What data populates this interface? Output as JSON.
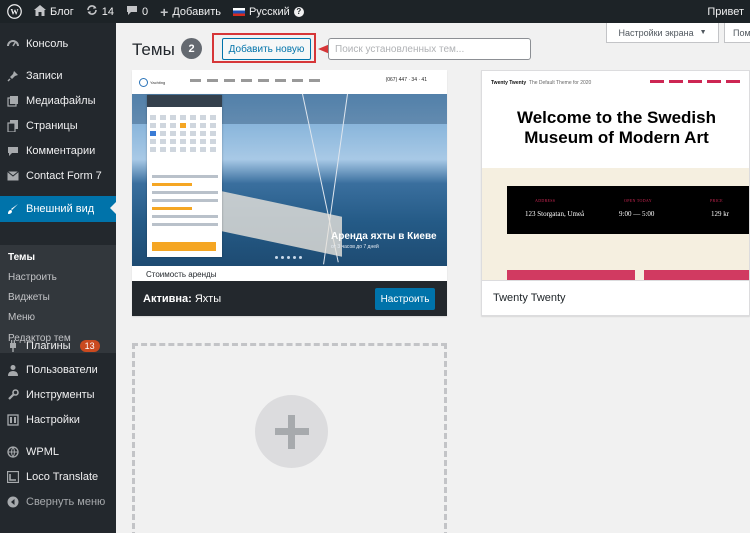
{
  "admin_bar": {
    "site_name": "Блог",
    "updates_count": "14",
    "comments_count": "0",
    "new_label": "Добавить",
    "language": "Русский",
    "greeting": "Привет"
  },
  "sidebar": {
    "items": [
      {
        "label": "Консоль",
        "icon": "dashboard-icon"
      },
      {
        "label": "Записи",
        "icon": "pin-icon"
      },
      {
        "label": "Медиафайлы",
        "icon": "media-icon"
      },
      {
        "label": "Страницы",
        "icon": "pages-icon"
      },
      {
        "label": "Комментарии",
        "icon": "comment-icon"
      },
      {
        "label": "Contact Form 7",
        "icon": "mail-icon"
      },
      {
        "label": "Внешний вид",
        "icon": "brush-icon"
      },
      {
        "label": "Плагины",
        "icon": "plug-icon",
        "badge": "13"
      },
      {
        "label": "Пользователи",
        "icon": "users-icon"
      },
      {
        "label": "Инструменты",
        "icon": "wrench-icon"
      },
      {
        "label": "Настройки",
        "icon": "settings-icon"
      },
      {
        "label": "WPML",
        "icon": "wpml-icon"
      },
      {
        "label": "Loco Translate",
        "icon": "translate-icon"
      }
    ],
    "submenu": [
      "Темы",
      "Настроить",
      "Виджеты",
      "Меню",
      "Редактор тем"
    ],
    "collapse_label": "Свернуть меню"
  },
  "header": {
    "title": "Темы",
    "count": "2",
    "add_new_label": "Добавить новую",
    "search_placeholder": "Поиск установленных тем...",
    "screen_options": "Настройки экрана",
    "help_label": "Помощь"
  },
  "themes": [
    {
      "name": "Яхты",
      "active_prefix": "Активна:",
      "customize_label": "Настроить",
      "shot_headline": "Аренда яхты в Киеве",
      "shot_sub": "от 3 часов до 7 дней",
      "shot_bottom": "Стоимость аренды",
      "shot_logo": "Yachting",
      "shot_phone": "(067) 447 · 34 · 41"
    },
    {
      "name": "Twenty Twenty",
      "shot_brand": "Twenty Twenty",
      "shot_tagline": "The Default Theme for 2020",
      "shot_title_line1": "Welcome to the Swedish",
      "shot_title_line2": "Museum of Modern Art",
      "shot_cols": [
        "ADDRESS",
        "OPEN TODAY",
        "PRICE"
      ],
      "shot_vals": [
        "123 Storgatan, Umeå",
        "9:00 — 5:00",
        "129 kr"
      ]
    }
  ],
  "colors": {
    "admin_bg": "#1d2327",
    "sidebar_bg": "#23282d",
    "accent": "#0073aa",
    "highlight_red": "#d63638",
    "badge": "#ca4a1f"
  }
}
